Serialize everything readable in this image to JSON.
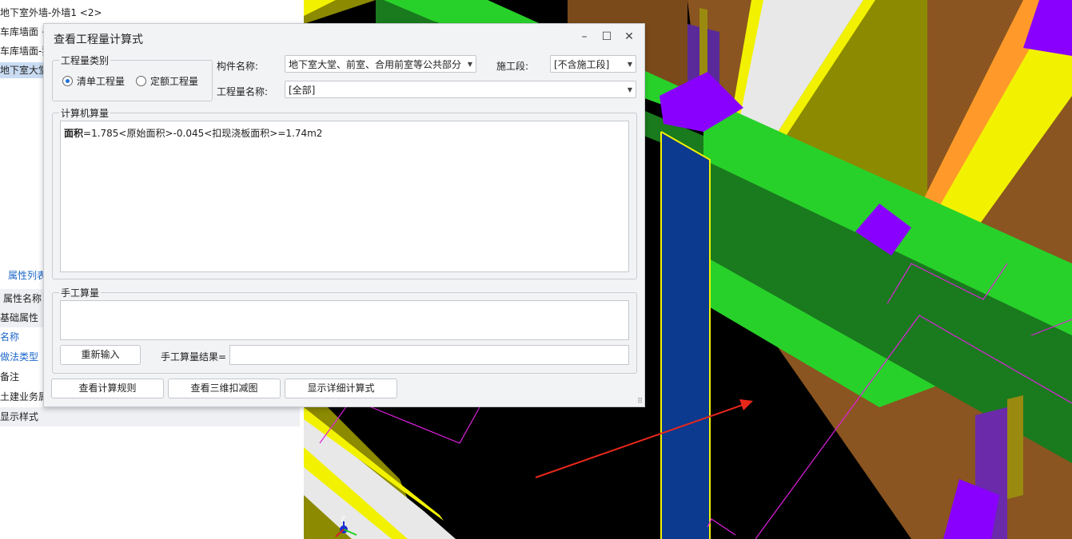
{
  "left_panel": {
    "tree_items": [
      "地下室外墙-外墙1 <2>",
      "车库墙面 <",
      "车库墙面-独",
      "地下室大堂"
    ],
    "tab_label": "属性列表",
    "prop_header": "属性名称",
    "props": [
      "基础属性",
      "名称",
      "做法类型",
      "备注",
      "土建业务属",
      "显示样式"
    ]
  },
  "dialog": {
    "title": "查看工程量计算式",
    "category_group": "工程量类别",
    "radio_qingdan": "清单工程量",
    "radio_dinge": "定额工程量",
    "component_label": "构件名称:",
    "component_value": "地下室大堂、前室、合用前室等公共部分",
    "stage_label": "施工段:",
    "stage_value": "[不含施工段]",
    "quantity_label": "工程量名称:",
    "quantity_value": "[全部]",
    "computer_group": "计算机算量",
    "formula_name": "面积",
    "formula_rest": "=1.785<原始面积>-0.045<扣现浇板面积>=1.74m2",
    "manual_group": "手工算量",
    "reinput_button": "重新输入",
    "manual_result_label": "手工算量结果=",
    "btn_rules": "查看计算规则",
    "btn_3d": "查看三维扣减图",
    "btn_detail": "显示详细计算式"
  },
  "viewport": {
    "axis_label": "Z"
  }
}
